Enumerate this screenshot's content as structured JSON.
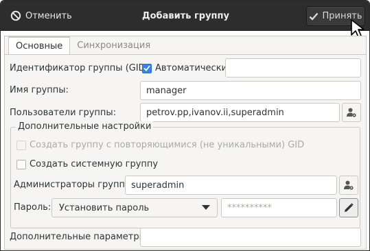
{
  "header": {
    "cancel_label": "Отменить",
    "title": "Добавить группу",
    "accept_label": "Принять"
  },
  "tabs": [
    {
      "label": "Основные",
      "active": true
    },
    {
      "label": "Синхронизация",
      "active": false
    }
  ],
  "form": {
    "gid_label": "Идентификатор группы (GID):",
    "gid_auto_label": "Автоматически",
    "gid_auto_checked": true,
    "gid_value": "",
    "name_label": "Имя группы:",
    "name_value": "manager",
    "users_label": "Пользователи группы:",
    "users_value": "petrov.pp,ivanov.ii,superadmin",
    "advanced": {
      "legend": "Дополнительные настройки",
      "nonunique_label": "Создать группу с повторяющимися (не уникальными) GID",
      "nonunique_checked": false,
      "nonunique_enabled": false,
      "system_label": "Создать системную группу",
      "system_checked": false,
      "admins_label": "Администраторы группы:",
      "admins_value": "superadmin",
      "password_label": "Пароль:",
      "password_mode": "Установить пароль",
      "password_value": "**********"
    },
    "extra_label": "Дополнительные параметры:",
    "extra_value": ""
  },
  "colors": {
    "header_bg": "#2d2d2d",
    "accent": "#3584e4"
  }
}
